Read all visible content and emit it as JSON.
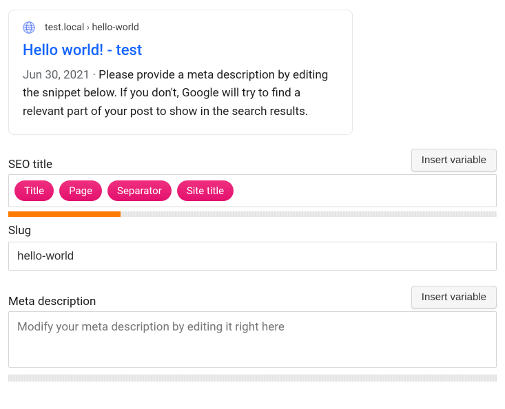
{
  "preview": {
    "domain": "test.local",
    "separator": "›",
    "slug": "hello-world",
    "title": "Hello world! - test",
    "date": "Jun 30, 2021",
    "dot": " · ",
    "description": "Please provide a meta description by editing the snippet below. If you don't, Google will try to find a relevant part of your post to show in the search results."
  },
  "seoTitle": {
    "label": "SEO title",
    "insertButton": "Insert variable",
    "pills": [
      "Title",
      "Page",
      "Separator",
      "Site title"
    ],
    "progressPercent": 23
  },
  "slug": {
    "label": "Slug",
    "value": "hello-world"
  },
  "metaDescription": {
    "label": "Meta description",
    "insertButton": "Insert variable",
    "placeholder": "Modify your meta description by editing it right here"
  }
}
